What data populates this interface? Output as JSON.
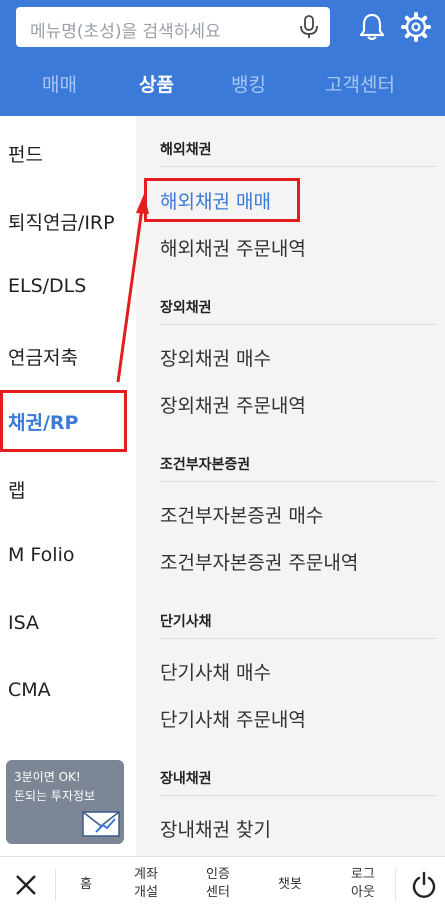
{
  "search": {
    "placeholder": "메뉴명(초성)을 검색하세요"
  },
  "icons": {
    "mic": "mic-icon",
    "bell": "bell-icon",
    "settings": "gear-icon",
    "close": "close-icon",
    "power": "power-icon",
    "chart_mail": "mail-chart-icon"
  },
  "tabs": [
    {
      "label": "매매"
    },
    {
      "label": "상품",
      "active": true
    },
    {
      "label": "뱅킹"
    },
    {
      "label": "고객센터"
    }
  ],
  "sidebar": {
    "items": [
      {
        "label": "펀드"
      },
      {
        "label": "퇴직연금/IRP"
      },
      {
        "label": "ELS/DLS"
      },
      {
        "label": "연금저축"
      },
      {
        "label": "채권/RP",
        "active": true
      },
      {
        "label": "랩"
      },
      {
        "label": "M Folio"
      },
      {
        "label": "ISA"
      },
      {
        "label": "CMA"
      }
    ],
    "promo": {
      "line1": "3분이면 OK!",
      "line2": "돈되는 투자정보"
    }
  },
  "menu": {
    "sections": [
      {
        "title": "해외채권",
        "items": [
          "해외채권 매매",
          "해외채권 주문내역"
        ]
      },
      {
        "title": "장외채권",
        "items": [
          "장외채권 매수",
          "장외채권 주문내역"
        ]
      },
      {
        "title": "조건부자본증권",
        "items": [
          "조건부자본증권 매수",
          "조건부자본증권 주문내역"
        ]
      },
      {
        "title": "단기사채",
        "items": [
          "단기사채 매수",
          "단기사채 주문내역"
        ]
      },
      {
        "title": "장내채권",
        "items": [
          "장내채권 찾기"
        ]
      }
    ]
  },
  "bottom_bar": {
    "home": "홈",
    "account_open": [
      "계좌",
      "개설"
    ],
    "auth_center": [
      "인증",
      "센터"
    ],
    "chatbot": "챗봇",
    "logout": [
      "로그",
      "아웃"
    ]
  },
  "colors": {
    "header": "#3b7ad8",
    "accent": "#3b7ad8",
    "highlight": "#e31d1d",
    "menu_bg": "#f4f4f4",
    "promo_bg": "#7d8694"
  }
}
